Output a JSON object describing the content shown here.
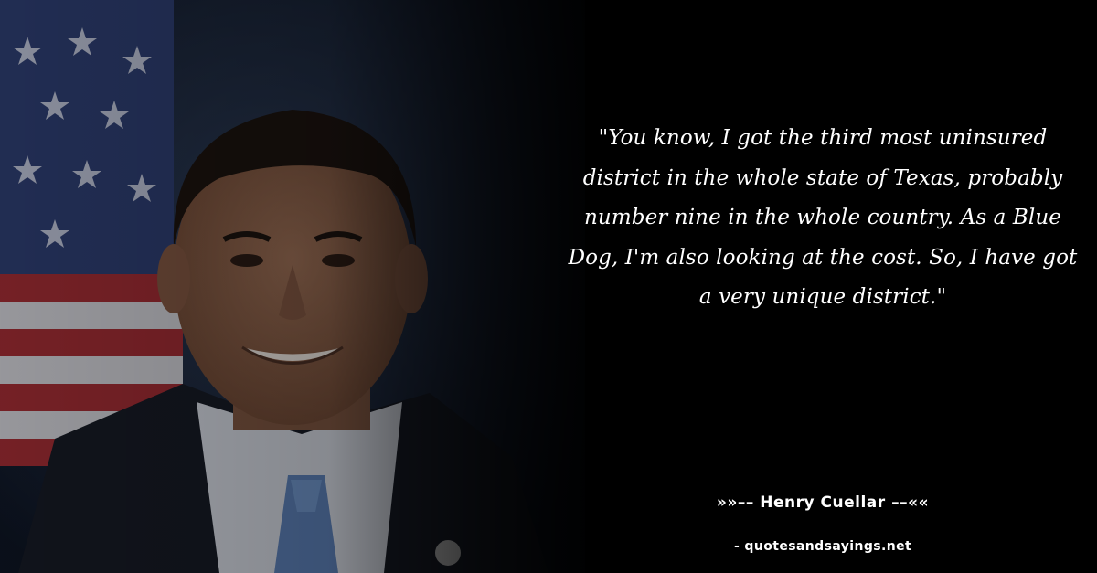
{
  "quote": {
    "text": "\"You know, I got the third most uninsured district in the whole state of Texas, probably number nine in the whole country. As a Blue Dog, I'm also looking at the cost. So, I have got a very unique district.\""
  },
  "attribution": {
    "author": "»»–– Henry Cuellar ––««"
  },
  "site": {
    "label": "- quotesandsayings.net"
  },
  "colors": {
    "background": "#000000",
    "text": "#ffffff"
  }
}
